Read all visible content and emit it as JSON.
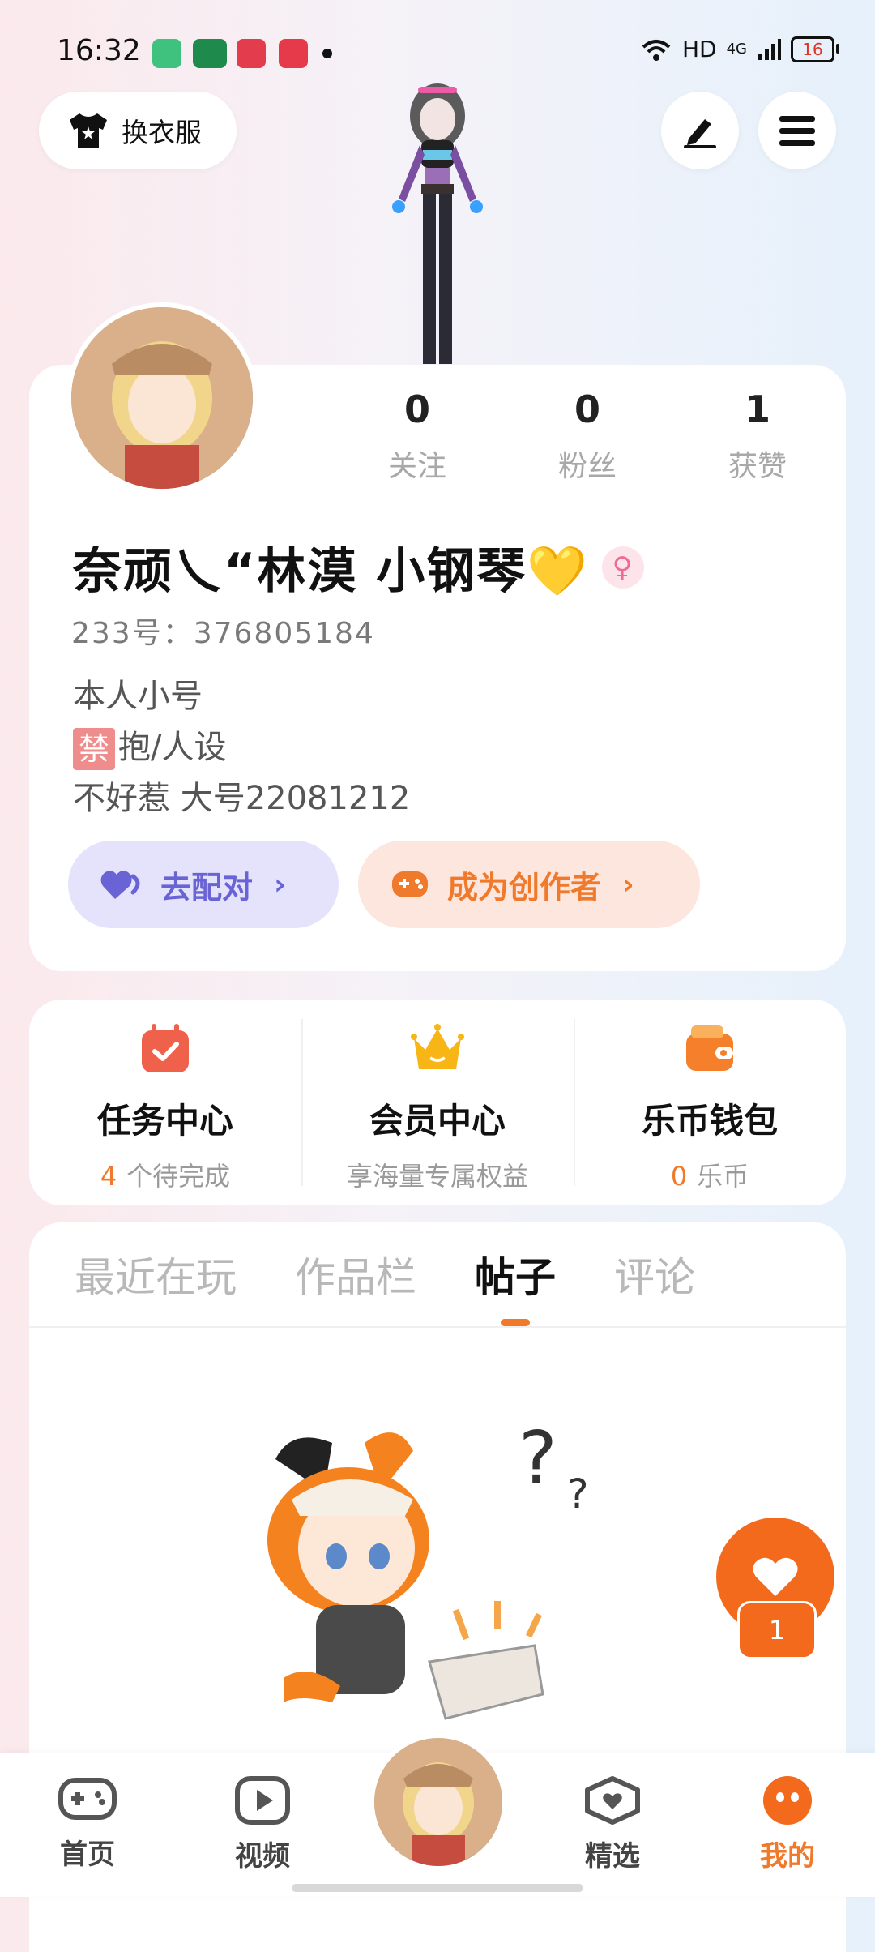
{
  "status_bar": {
    "time": "16:32",
    "network": "HD",
    "signal": "4G",
    "battery": "16"
  },
  "top": {
    "outfit_label": "换衣服"
  },
  "profile": {
    "stats": [
      {
        "value": "0",
        "label": "关注"
      },
      {
        "value": "0",
        "label": "粉丝"
      },
      {
        "value": "1",
        "label": "获赞"
      }
    ],
    "nickname": "奈顽乀“林漠 小钢琴💛",
    "gender_symbol": "♀",
    "user_id": "233号：376805184",
    "bio": {
      "line1": "本人小号",
      "ban_badge": "禁",
      "line2": "抱/人设",
      "line3": "不好惹  大号22081212"
    },
    "match_button": "去配对",
    "creator_button": "成为创作者",
    "chevron": "›"
  },
  "centers": [
    {
      "title": "任务中心",
      "sub_highlight": "4",
      "sub": "个待完成"
    },
    {
      "title": "会员中心",
      "sub_highlight": "",
      "sub": "享海量专属权益"
    },
    {
      "title": "乐币钱包",
      "sub_highlight": "0",
      "sub": "乐币"
    }
  ],
  "tabs": [
    "最近在玩",
    "作品栏",
    "帖子",
    "评论"
  ],
  "active_tab": "帖子",
  "float_badge": "1",
  "bottom_nav": {
    "items": [
      {
        "label": "首页",
        "icon": "gamepad-icon"
      },
      {
        "label": "视频",
        "icon": "video-icon"
      },
      {
        "label": "精选",
        "icon": "heart-box-icon"
      },
      {
        "label": "我的",
        "icon": "me-icon"
      }
    ]
  },
  "colors": {
    "accent": "#f07a2c",
    "match": "#6a63d6",
    "float": "#f36a1d"
  }
}
